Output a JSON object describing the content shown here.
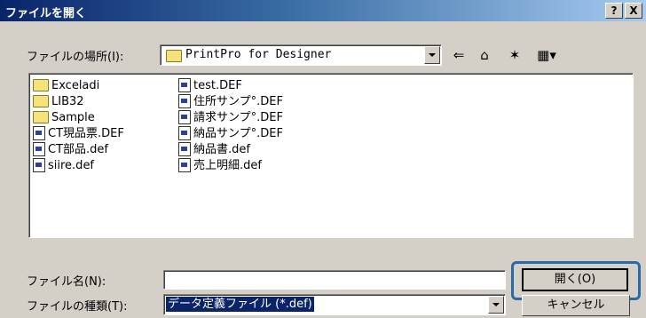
{
  "window": {
    "title": "ファイルを開く",
    "help_label": "?",
    "close_label": "X"
  },
  "look_in": {
    "label": "ファイルの場所(I):",
    "value": "PrintPro for Designer"
  },
  "toolbar": {
    "back_icon": "back-arrow-icon",
    "up_icon": "up-folder-icon",
    "new_folder_icon": "new-folder-icon",
    "view_icon": "view-menu-icon"
  },
  "files": [
    {
      "name": "Exceladi",
      "type": "folder"
    },
    {
      "name": "LIB32",
      "type": "folder"
    },
    {
      "name": "Sample",
      "type": "folder"
    },
    {
      "name": "CT現品票.DEF",
      "type": "file"
    },
    {
      "name": "CT部品.def",
      "type": "file"
    },
    {
      "name": "siire.def",
      "type": "file"
    },
    {
      "name": "test.DEF",
      "type": "file"
    },
    {
      "name": "住所サンプ°.DEF",
      "type": "file"
    },
    {
      "name": "請求サンプ°.DEF",
      "type": "file"
    },
    {
      "name": "納品サンプ°.DEF",
      "type": "file"
    },
    {
      "name": "納品書.def",
      "type": "file"
    },
    {
      "name": "売上明細.def",
      "type": "file"
    }
  ],
  "filename": {
    "label": "ファイル名(N):",
    "value": ""
  },
  "filetype": {
    "label": "ファイルの種類(T):",
    "value": "データ定義ファイル (*.def)"
  },
  "buttons": {
    "open": "開く(O)",
    "cancel": "キャンセル"
  }
}
